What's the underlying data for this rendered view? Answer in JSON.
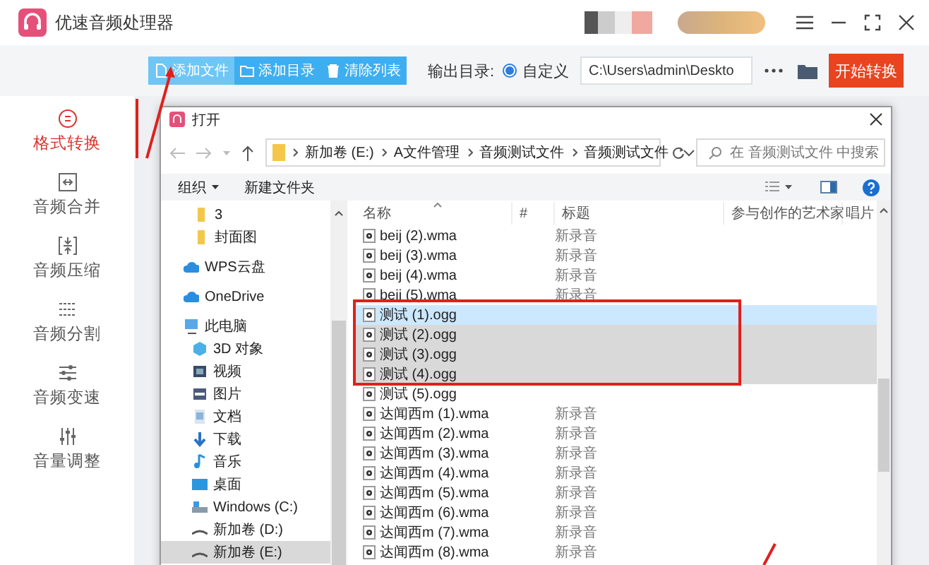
{
  "app": {
    "title": "优速音频处理器"
  },
  "toolbar": {
    "buttons": [
      {
        "label": "添加文件",
        "kind": "file",
        "hovered": true
      },
      {
        "label": "添加目录",
        "kind": "folder",
        "hovered": false
      },
      {
        "label": "清除列表",
        "kind": "trash",
        "hovered": false
      }
    ],
    "output": {
      "label": "输出目录:",
      "option": {
        "label": "自定义",
        "selected": true
      },
      "path": "C:\\Users\\admin\\Deskto"
    },
    "start_button": "开始转换"
  },
  "sidebar": {
    "items": [
      {
        "label": "格式转换",
        "kind": "convert",
        "selected": true
      },
      {
        "label": "音频合并",
        "kind": "merge",
        "selected": false
      },
      {
        "label": "音频压缩",
        "kind": "compress",
        "selected": false
      },
      {
        "label": "音频分割",
        "kind": "split",
        "selected": false
      },
      {
        "label": "音频变速",
        "kind": "speed",
        "selected": false
      },
      {
        "label": "音量调整",
        "kind": "volume",
        "selected": false
      }
    ]
  },
  "dialog": {
    "title": "打开",
    "breadcrumb": [
      "新加卷 (E:)",
      "A文件管理",
      "音频测试文件",
      "音频测试文件"
    ],
    "search": {
      "placeholder": "在 音频测试文件 中搜索"
    },
    "commands": [
      {
        "label": "组织",
        "dropdown": true
      },
      {
        "label": "新建文件夹",
        "dropdown": false
      }
    ],
    "nav": [
      {
        "label": "3",
        "kind": "folder",
        "selected": false
      },
      {
        "label": "封面图",
        "kind": "folder",
        "selected": false
      },
      {
        "label": "WPS云盘",
        "kind": "cloud",
        "selected": false
      },
      {
        "label": "OneDrive",
        "kind": "cloud",
        "selected": false
      },
      {
        "label": "此电脑",
        "kind": "pc",
        "selected": false,
        "children": [
          {
            "label": "3D 对象",
            "kind": "cube",
            "selected": false
          },
          {
            "label": "视频",
            "kind": "video",
            "selected": false
          },
          {
            "label": "图片",
            "kind": "picture",
            "selected": false
          },
          {
            "label": "文档",
            "kind": "document",
            "selected": false
          },
          {
            "label": "下载",
            "kind": "download",
            "selected": false
          },
          {
            "label": "音乐",
            "kind": "music",
            "selected": false
          },
          {
            "label": "桌面",
            "kind": "desktop",
            "selected": false
          },
          {
            "label": "Windows (C:)",
            "kind": "system-drive",
            "selected": false
          },
          {
            "label": "新加卷 (D:)",
            "kind": "drive",
            "selected": false
          },
          {
            "label": "新加卷 (E:)",
            "kind": "drive",
            "selected": true
          }
        ]
      }
    ],
    "columns": [
      "名称",
      "#",
      "标题",
      "参与创作的艺术家",
      "唱片"
    ],
    "files": [
      {
        "name": "beij (2).wma",
        "title": "新录音",
        "selected": false,
        "focused": false
      },
      {
        "name": "beij (3).wma",
        "title": "新录音",
        "selected": false,
        "focused": false
      },
      {
        "name": "beij (4).wma",
        "title": "新录音",
        "selected": false,
        "focused": false
      },
      {
        "name": "beij (5).wma",
        "title": "新录音",
        "selected": false,
        "focused": false
      },
      {
        "name": "测试 (1).ogg",
        "selected": true,
        "focused": true
      },
      {
        "name": "测试 (2).ogg",
        "selected": true,
        "focused": false
      },
      {
        "name": "测试 (3).ogg",
        "selected": true,
        "focused": false
      },
      {
        "name": "测试 (4).ogg",
        "selected": true,
        "focused": false
      },
      {
        "name": "测试 (5).ogg",
        "selected": false,
        "focused": false
      },
      {
        "name": "达闻西m (1).wma",
        "title": "新录音",
        "selected": false,
        "focused": false
      },
      {
        "name": "达闻西m (2).wma",
        "title": "新录音",
        "selected": false,
        "focused": false
      },
      {
        "name": "达闻西m (3).wma",
        "title": "新录音",
        "selected": false,
        "focused": false
      },
      {
        "name": "达闻西m (4).wma",
        "title": "新录音",
        "selected": false,
        "focused": false
      },
      {
        "name": "达闻西m (5).wma",
        "title": "新录音",
        "selected": false,
        "focused": false
      },
      {
        "name": "达闻西m (6).wma",
        "title": "新录音",
        "selected": false,
        "focused": false
      },
      {
        "name": "达闻西m (7).wma",
        "title": "新录音",
        "selected": false,
        "focused": false
      },
      {
        "name": "达闻西m (8).wma",
        "title": "新录音",
        "selected": false,
        "focused": false
      }
    ]
  },
  "annotations": [
    {
      "kind": "line"
    },
    {
      "kind": "arrow"
    },
    {
      "kind": "box"
    },
    {
      "kind": "line"
    }
  ]
}
